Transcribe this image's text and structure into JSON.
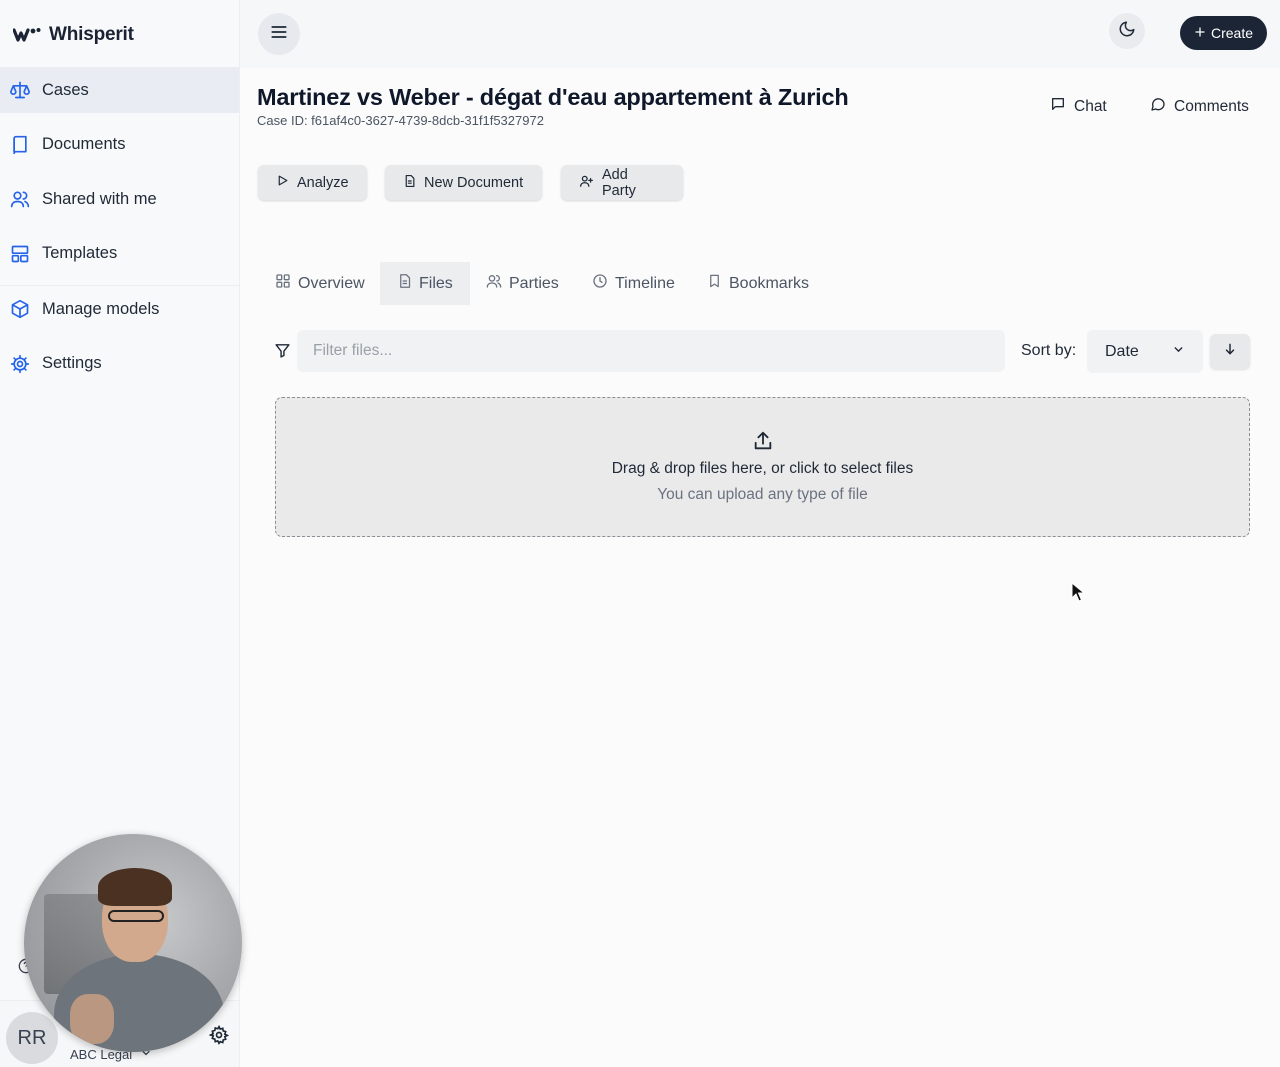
{
  "app": {
    "name": "Whisperit"
  },
  "sidebar": {
    "items": [
      {
        "label": "Cases",
        "icon": "scale-icon",
        "active": true
      },
      {
        "label": "Documents",
        "icon": "book-icon",
        "active": false
      },
      {
        "label": "Shared with me",
        "icon": "users-icon",
        "active": false
      },
      {
        "label": "Templates",
        "icon": "layout-icon",
        "active": false
      },
      {
        "label": "Manage models",
        "icon": "cube-icon",
        "active": false
      },
      {
        "label": "Settings",
        "icon": "gear-icon",
        "active": false
      }
    ],
    "user": {
      "initials": "RR",
      "org": "ABC Legal"
    }
  },
  "topbar": {
    "create_label": "Create"
  },
  "case": {
    "title": "Martinez vs Weber - dégat d'eau appartement à Zurich",
    "case_id": "Case ID: f61af4c0-3627-4739-8dcb-31f1f5327972",
    "chat_label": "Chat",
    "comments_label": "Comments"
  },
  "actions": {
    "analyze": "Analyze",
    "new_document": "New Document",
    "add_party": "Add Party"
  },
  "tabs": [
    {
      "label": "Overview",
      "icon": "grid-icon",
      "active": false
    },
    {
      "label": "Files",
      "icon": "file-icon",
      "active": true
    },
    {
      "label": "Parties",
      "icon": "users-icon",
      "active": false
    },
    {
      "label": "Timeline",
      "icon": "clock-icon",
      "active": false
    },
    {
      "label": "Bookmarks",
      "icon": "bookmark-icon",
      "active": false
    }
  ],
  "files": {
    "filter_placeholder": "Filter files...",
    "sort_label": "Sort by:",
    "sort_value": "Date",
    "dropzone_main": "Drag & drop files here, or click to select files",
    "dropzone_sub": "You can upload any type of file"
  },
  "colors": {
    "primary_dark": "#1b2536",
    "accent_blue": "#2563eb",
    "active_bg": "#e9edf3"
  }
}
